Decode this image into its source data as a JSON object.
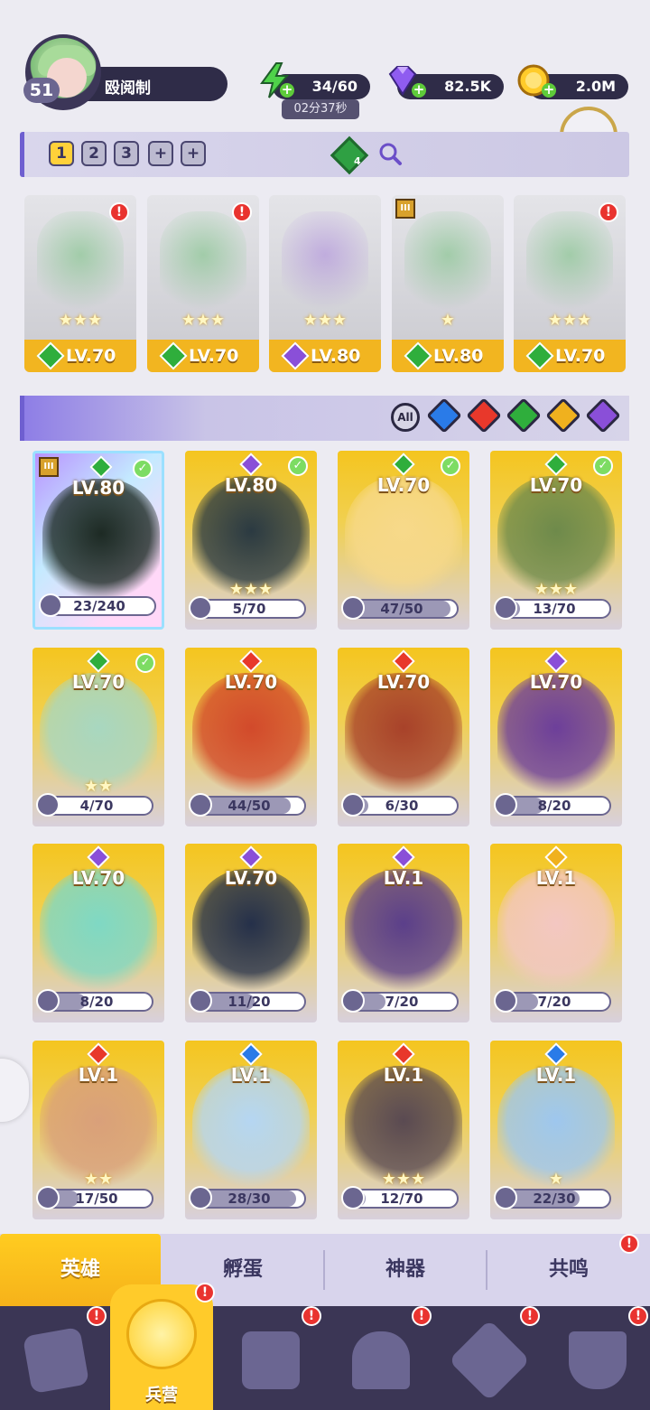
{
  "player": {
    "level": "51",
    "name": "殴阅制"
  },
  "resources": {
    "energy": {
      "value": "34/60",
      "timer": "02分37秒"
    },
    "gems": {
      "value": "82.5K"
    },
    "gold": {
      "value": "2.0M"
    }
  },
  "team_tabs": [
    "1",
    "2",
    "3",
    "+",
    "+"
  ],
  "team_gem_count": "4",
  "team": [
    {
      "level": "LV.70",
      "element": "nature",
      "element_color": "#2fae3c",
      "alert": true,
      "rank": "",
      "stars": "★★★"
    },
    {
      "level": "LV.70",
      "element": "nature",
      "element_color": "#2fae3c",
      "alert": true,
      "rank": "",
      "stars": "★★★"
    },
    {
      "level": "LV.80",
      "element": "dark",
      "element_color": "#8a4fd8",
      "alert": false,
      "rank": "",
      "stars": "★★★"
    },
    {
      "level": "LV.80",
      "element": "nature",
      "element_color": "#2fae3c",
      "alert": false,
      "rank": "III",
      "stars": "★"
    },
    {
      "level": "LV.70",
      "element": "nature",
      "element_color": "#2fae3c",
      "alert": true,
      "rank": "",
      "stars": "★★★"
    }
  ],
  "filters": {
    "all_label": "All",
    "elements": [
      {
        "name": "water",
        "color": "#2a7be8"
      },
      {
        "name": "fire",
        "color": "#e8382b"
      },
      {
        "name": "nature",
        "color": "#2fae3c"
      },
      {
        "name": "light",
        "color": "#f0b11e"
      },
      {
        "name": "dark",
        "color": "#8a4fd8"
      }
    ]
  },
  "heroes": [
    {
      "level": "LV.80",
      "element_color": "#2fae3c",
      "fragments": "23/240",
      "progress": 0.1,
      "checked": true,
      "rank": "III",
      "featured": true,
      "art": "#1d2a24"
    },
    {
      "level": "LV.80",
      "element_color": "#8a4fd8",
      "fragments": "5/70",
      "progress": 0.07,
      "checked": true,
      "rank": "",
      "featured": false,
      "art": "#2b3a42"
    },
    {
      "level": "LV.70",
      "element_color": "#2fae3c",
      "fragments": "47/50",
      "progress": 0.94,
      "checked": true,
      "rank": "",
      "featured": false,
      "art": "#f7d98a"
    },
    {
      "level": "LV.70",
      "element_color": "#2fae3c",
      "fragments": "13/70",
      "progress": 0.19,
      "checked": true,
      "rank": "",
      "featured": false,
      "art": "#6e8a4b"
    },
    {
      "level": "LV.70",
      "element_color": "#2fae3c",
      "fragments": "4/70",
      "progress": 0.06,
      "checked": true,
      "rank": "",
      "featured": false,
      "art": "#a8d7c0"
    },
    {
      "level": "LV.70",
      "element_color": "#e8382b",
      "fragments": "44/50",
      "progress": 0.88,
      "checked": false,
      "rank": "",
      "featured": false,
      "art": "#d24a2b"
    },
    {
      "level": "LV.70",
      "element_color": "#e8382b",
      "fragments": "6/30",
      "progress": 0.2,
      "checked": false,
      "rank": "",
      "featured": false,
      "art": "#a8422a"
    },
    {
      "level": "LV.70",
      "element_color": "#8a4fd8",
      "fragments": "8/20",
      "progress": 0.4,
      "checked": false,
      "rank": "",
      "featured": false,
      "art": "#6d3f9a"
    },
    {
      "level": "LV.70",
      "element_color": "#8a4fd8",
      "fragments": "8/20",
      "progress": 0.4,
      "checked": false,
      "rank": "",
      "featured": false,
      "art": "#7fd8c4"
    },
    {
      "level": "LV.70",
      "element_color": "#8a4fd8",
      "fragments": "11/20",
      "progress": 0.55,
      "checked": false,
      "rank": "",
      "featured": false,
      "art": "#25304a"
    },
    {
      "level": "LV.1",
      "element_color": "#8a4fd8",
      "fragments": "7/20",
      "progress": 0.35,
      "checked": false,
      "rank": "",
      "featured": false,
      "art": "#5b3f8a"
    },
    {
      "level": "LV.1",
      "element_color": "#f0b11e",
      "fragments": "7/20",
      "progress": 0.35,
      "checked": false,
      "rank": "",
      "featured": false,
      "art": "#f3c7c2"
    },
    {
      "level": "LV.1",
      "element_color": "#e8382b",
      "fragments": "17/50",
      "progress": 0.34,
      "checked": false,
      "rank": "",
      "featured": false,
      "art": "#d9a07a"
    },
    {
      "level": "LV.1",
      "element_color": "#2a7be8",
      "fragments": "28/30",
      "progress": 0.93,
      "checked": false,
      "rank": "",
      "featured": false,
      "art": "#b5d6f2"
    },
    {
      "level": "LV.1",
      "element_color": "#e8382b",
      "fragments": "12/70",
      "progress": 0.17,
      "checked": false,
      "rank": "",
      "featured": false,
      "art": "#5a4a52"
    },
    {
      "level": "LV.1",
      "element_color": "#2a7be8",
      "fragments": "22/30",
      "progress": 0.73,
      "checked": false,
      "rank": "",
      "featured": false,
      "art": "#9ec7ee"
    }
  ],
  "hero_stars": [
    "",
    "★★★",
    "",
    "★★★",
    "★★",
    "",
    "",
    "",
    "",
    "",
    "",
    "",
    "★★",
    "",
    "★★★",
    "★"
  ],
  "subtabs": [
    "英雄",
    "孵蛋",
    "神器",
    "共鸣"
  ],
  "nav": {
    "active_label": "兵营"
  }
}
